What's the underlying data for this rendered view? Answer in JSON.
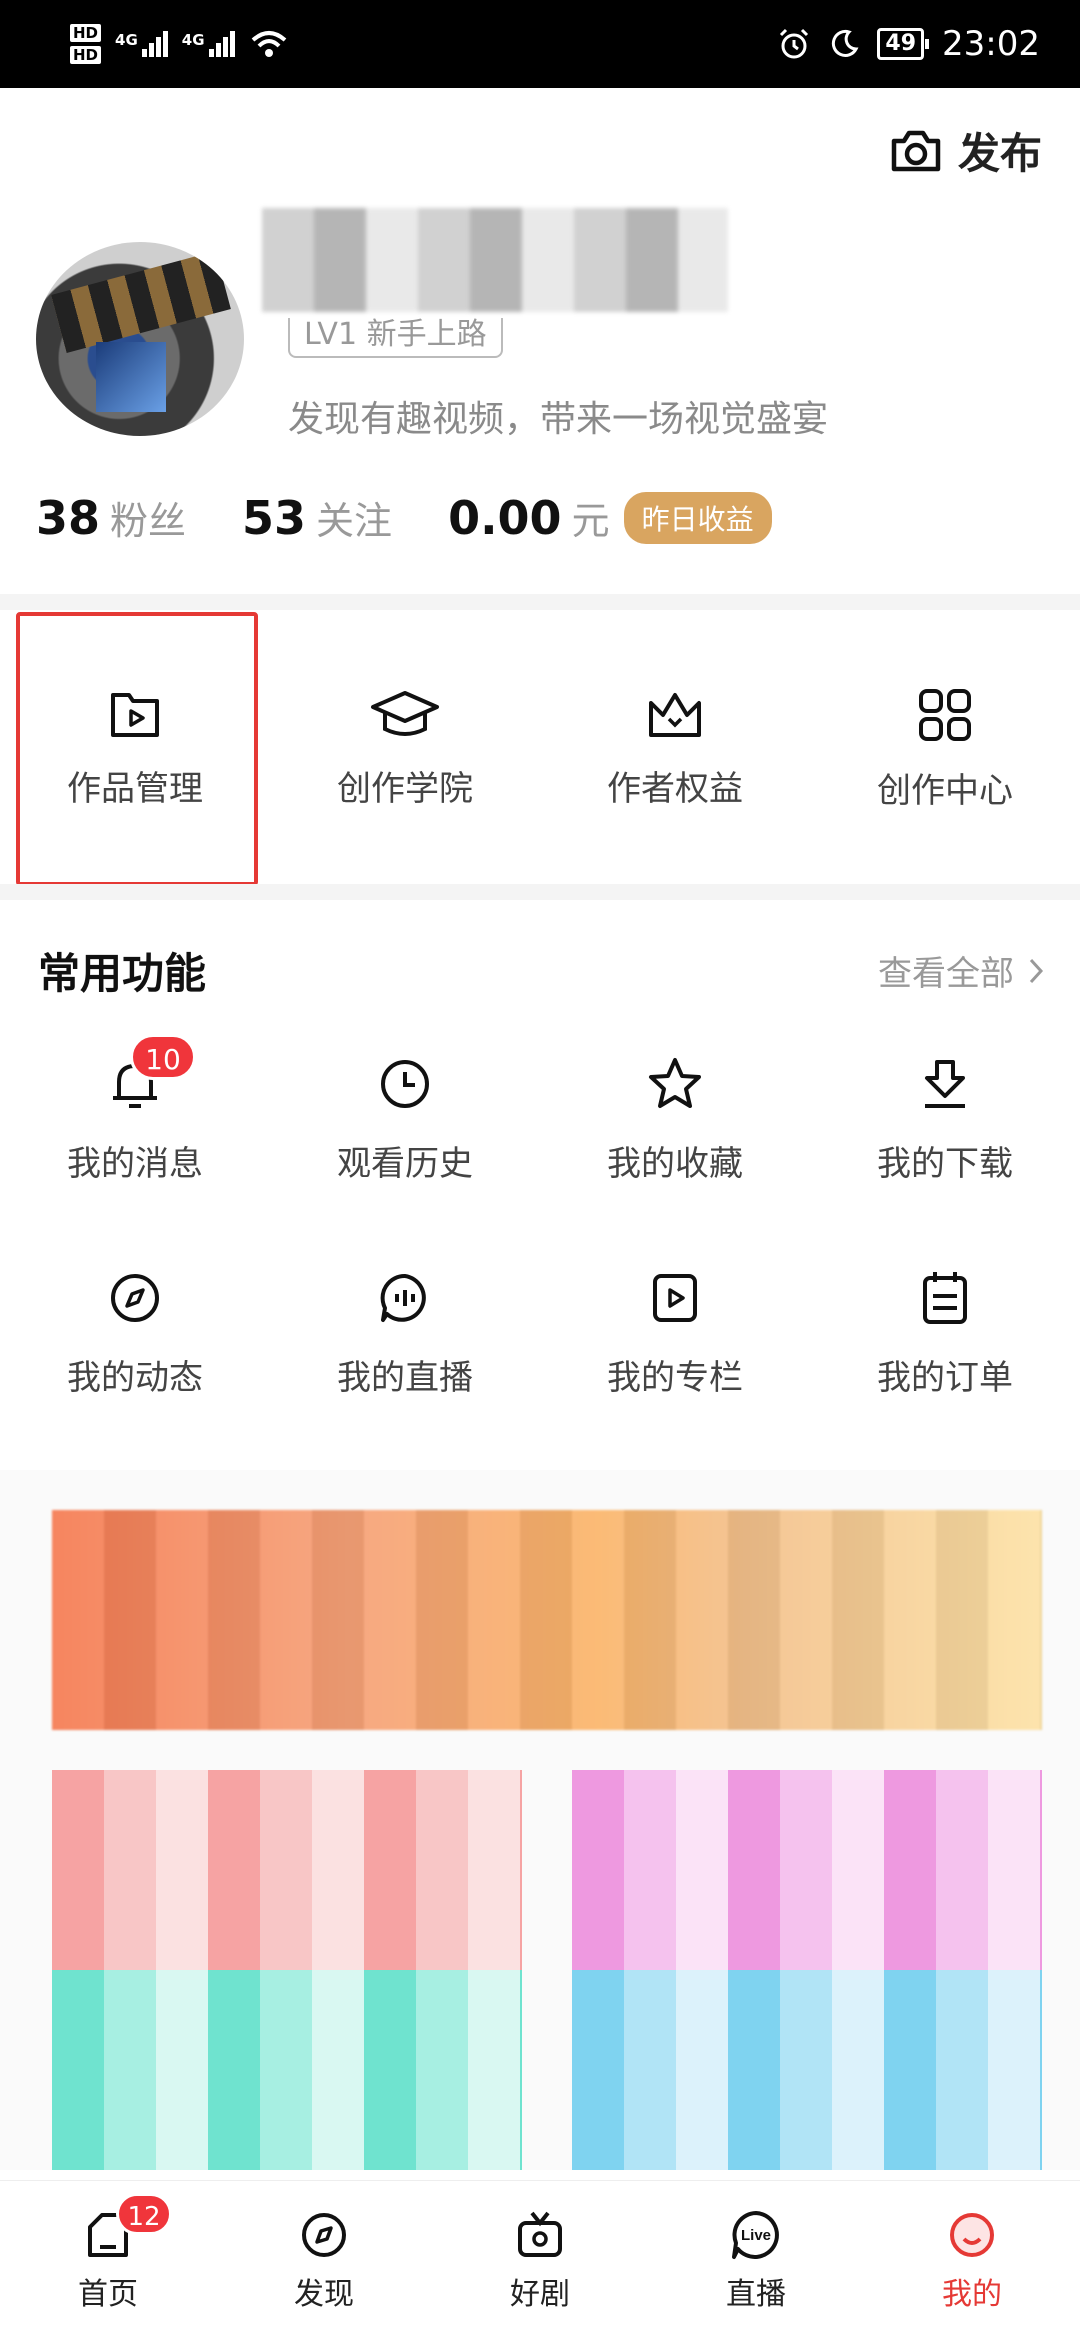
{
  "status_bar": {
    "hd1": "HD",
    "hd2": "HD",
    "net1": "4G",
    "net2": "4G",
    "battery": "49",
    "time": "23:02"
  },
  "header": {
    "publish_label": "发布"
  },
  "profile": {
    "level": "LV1 新手上路",
    "bio": "发现有趣视频，带来一场视觉盛宴"
  },
  "stats": {
    "fans_value": "38",
    "fans_label": "粉丝",
    "follow_value": "53",
    "follow_label": "关注",
    "earnings_value": "0.00",
    "earnings_unit": "元",
    "earnings_badge": "昨日收益"
  },
  "creator": {
    "items": [
      {
        "label": "作品管理",
        "icon": "video-folder-icon"
      },
      {
        "label": "创作学院",
        "icon": "graduation-cap-icon"
      },
      {
        "label": "作者权益",
        "icon": "crown-icon"
      },
      {
        "label": "创作中心",
        "icon": "grid-icon"
      }
    ]
  },
  "common": {
    "title": "常用功能",
    "see_all": "查看全部",
    "items": [
      {
        "label": "我的消息",
        "icon": "bell-icon",
        "badge": "10"
      },
      {
        "label": "观看历史",
        "icon": "clock-icon"
      },
      {
        "label": "我的收藏",
        "icon": "star-icon"
      },
      {
        "label": "我的下载",
        "icon": "download-icon"
      },
      {
        "label": "我的动态",
        "icon": "compass-icon"
      },
      {
        "label": "我的直播",
        "icon": "live-audio-icon"
      },
      {
        "label": "我的专栏",
        "icon": "play-box-icon"
      },
      {
        "label": "我的订单",
        "icon": "order-icon"
      }
    ]
  },
  "bottom_nav": {
    "items": [
      {
        "label": "首页",
        "icon": "home-icon",
        "badge": "12"
      },
      {
        "label": "发现",
        "icon": "compass-icon"
      },
      {
        "label": "好剧",
        "icon": "tv-icon"
      },
      {
        "label": "直播",
        "icon": "live-icon",
        "icon_text": "Live"
      },
      {
        "label": "我的",
        "icon": "profile-icon"
      }
    ]
  },
  "colors": {
    "accent_red": "#e53935",
    "badge_red": "#f0353b",
    "earnings_gold": "#d9a560"
  }
}
